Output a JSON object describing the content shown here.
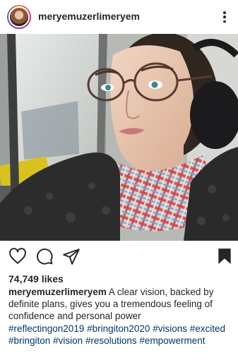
{
  "post": {
    "username": "meryemuzerlimeryem",
    "likes": "74,749 likes",
    "caption_user": "meryemuzerlimeryem",
    "caption_text": "A clear vision, backed by definite plans, gives you a tremendous feeling of confidence and personal power",
    "hashtags": [
      "#reflectingon2019",
      "#bringiton2020",
      "#visions",
      "#excited",
      "#bringiton",
      "#vision",
      "#resolutions",
      "#empowerment"
    ]
  },
  "icons": {
    "like": "heart-icon",
    "comment": "comment-icon",
    "share": "paper-plane-icon",
    "save": "bookmark-icon",
    "more": "more-options-icon"
  },
  "colors": {
    "text": "#262626",
    "hashtag": "#00376b",
    "background": "#ffffff"
  }
}
